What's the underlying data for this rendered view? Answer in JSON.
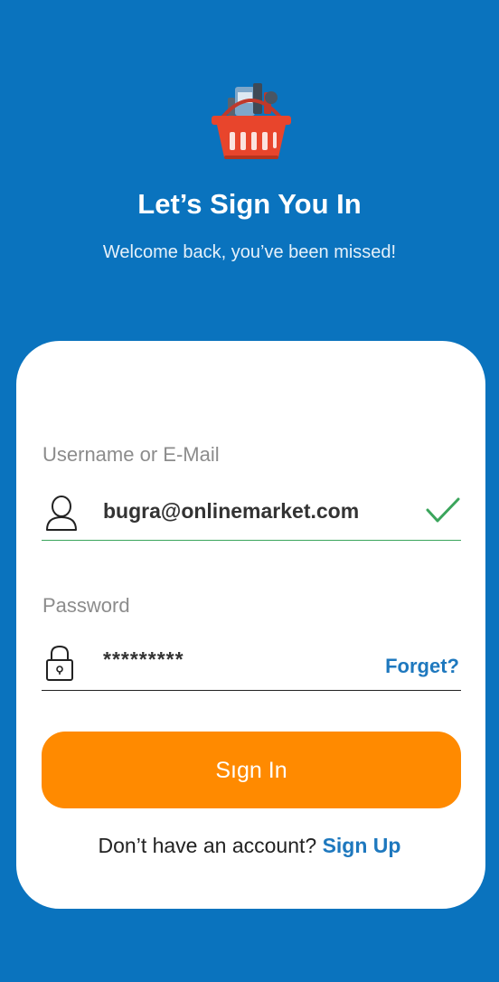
{
  "header": {
    "logo_icon": "shopping-basket-icon",
    "title": "Let’s Sign You In",
    "subtitle": "Welcome back, you’ve been missed!"
  },
  "form": {
    "username": {
      "label": "Username or E-Mail",
      "value": "bugra@onlinemarket.com",
      "icon": "user-icon",
      "status_icon": "checkmark-icon",
      "underline_color": "#3BA55C"
    },
    "password": {
      "label": "Password",
      "value": "*********",
      "icon": "lock-icon",
      "forget_label": "Forget?",
      "underline_color": "#222222"
    },
    "signin_label": "Sıgn In",
    "signup_prompt": "Don’t have an account?",
    "signup_label": "Sign Up"
  },
  "colors": {
    "background": "#0A73BE",
    "accent_button": "#FF8A00",
    "link": "#1E78BE",
    "success": "#3BA55C"
  }
}
